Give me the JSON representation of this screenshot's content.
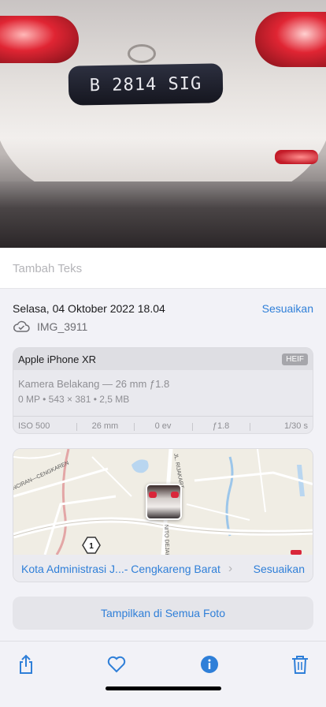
{
  "photo": {
    "plate_text": "B 2814 SIG"
  },
  "caption": {
    "placeholder": "Tambah Teks"
  },
  "info": {
    "datetime": "Selasa, 04 Oktober 2022 18.04",
    "adjust_label": "Sesuaikan",
    "filename": "IMG_3911",
    "filename_icon": "icloud-check-icon"
  },
  "camera": {
    "model": "Apple iPhone XR",
    "format_badge": "HEIF",
    "lens": "Kamera Belakang — 26 mm ƒ1.8",
    "details": "0 MP  •  543 × 381  •  2,5 MB",
    "exif": [
      "ISO 500",
      "26 mm",
      "0 ev",
      "ƒ1.8",
      "1/30 s"
    ]
  },
  "map": {
    "road_label_1": "NCIRAN—CENGKAREN",
    "road_label_2": "JL. RIJAKART",
    "road_label_3": "NITO DEJAKA",
    "route_badge": "1",
    "location": "Kota Administrasi J...- Cengkareng Barat",
    "adjust_label": "Sesuaikan"
  },
  "actions": {
    "show_all_label": "Tampilkan di Semua Foto"
  },
  "toolbar": {
    "share_icon": "share-icon",
    "favorite_icon": "heart-icon",
    "info_icon": "info-icon",
    "delete_icon": "trash-icon"
  },
  "colors": {
    "accent": "#2f7fd8",
    "background": "#f2f2f7"
  }
}
